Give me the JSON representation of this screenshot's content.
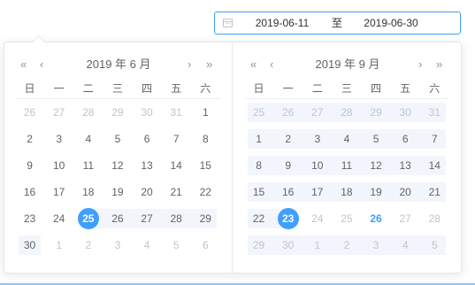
{
  "range_input": {
    "start": "2019-06-11",
    "separator": "至",
    "end": "2019-06-30"
  },
  "left": {
    "title": "2019 年 6 月",
    "weekdays": [
      "日",
      "一",
      "二",
      "三",
      "四",
      "五",
      "六"
    ],
    "rows": [
      [
        {
          "d": "26",
          "o": 1
        },
        {
          "d": "27",
          "o": 1
        },
        {
          "d": "28",
          "o": 1
        },
        {
          "d": "29",
          "o": 1
        },
        {
          "d": "30",
          "o": 1
        },
        {
          "d": "31",
          "o": 1
        },
        {
          "d": "1"
        }
      ],
      [
        {
          "d": "2"
        },
        {
          "d": "3"
        },
        {
          "d": "4"
        },
        {
          "d": "5"
        },
        {
          "d": "6"
        },
        {
          "d": "7"
        },
        {
          "d": "8"
        }
      ],
      [
        {
          "d": "9"
        },
        {
          "d": "10"
        },
        {
          "d": "11"
        },
        {
          "d": "12"
        },
        {
          "d": "13"
        },
        {
          "d": "14"
        },
        {
          "d": "15"
        }
      ],
      [
        {
          "d": "16"
        },
        {
          "d": "17"
        },
        {
          "d": "18"
        },
        {
          "d": "19"
        },
        {
          "d": "20"
        },
        {
          "d": "21"
        },
        {
          "d": "22"
        }
      ],
      [
        {
          "d": "23"
        },
        {
          "d": "24"
        },
        {
          "d": "25",
          "s": 1,
          "r": "start"
        },
        {
          "d": "26",
          "r": 1
        },
        {
          "d": "27",
          "r": 1
        },
        {
          "d": "28",
          "r": 1
        },
        {
          "d": "29",
          "r": 1
        }
      ],
      [
        {
          "d": "30",
          "r": 1
        },
        {
          "d": "1",
          "o": 1
        },
        {
          "d": "2",
          "o": 1
        },
        {
          "d": "3",
          "o": 1
        },
        {
          "d": "4",
          "o": 1
        },
        {
          "d": "5",
          "o": 1
        },
        {
          "d": "6",
          "o": 1
        }
      ]
    ]
  },
  "right": {
    "title": "2019 年 9 月",
    "weekdays": [
      "日",
      "一",
      "二",
      "三",
      "四",
      "五",
      "六"
    ],
    "rows": [
      [
        {
          "d": "25",
          "o": 1,
          "r": 1
        },
        {
          "d": "26",
          "o": 1,
          "r": 1
        },
        {
          "d": "27",
          "o": 1,
          "r": 1
        },
        {
          "d": "28",
          "o": 1,
          "r": 1
        },
        {
          "d": "29",
          "o": 1,
          "r": 1
        },
        {
          "d": "30",
          "o": 1,
          "r": 1
        },
        {
          "d": "31",
          "o": 1,
          "r": 1
        }
      ],
      [
        {
          "d": "1",
          "r": 1
        },
        {
          "d": "2",
          "r": 1
        },
        {
          "d": "3",
          "r": 1
        },
        {
          "d": "4",
          "r": 1
        },
        {
          "d": "5",
          "r": 1
        },
        {
          "d": "6",
          "r": 1
        },
        {
          "d": "7",
          "r": 1
        }
      ],
      [
        {
          "d": "8",
          "r": 1
        },
        {
          "d": "9",
          "r": 1
        },
        {
          "d": "10",
          "r": 1
        },
        {
          "d": "11",
          "r": 1
        },
        {
          "d": "12",
          "r": 1
        },
        {
          "d": "13",
          "r": 1
        },
        {
          "d": "14",
          "r": 1
        }
      ],
      [
        {
          "d": "15",
          "r": 1
        },
        {
          "d": "16",
          "r": 1
        },
        {
          "d": "17",
          "r": 1
        },
        {
          "d": "18",
          "r": 1
        },
        {
          "d": "19",
          "r": 1
        },
        {
          "d": "20",
          "r": 1
        },
        {
          "d": "21",
          "r": 1
        }
      ],
      [
        {
          "d": "22",
          "r": 1
        },
        {
          "d": "23",
          "s": 1,
          "r": "end"
        },
        {
          "d": "24",
          "o": 1
        },
        {
          "d": "25",
          "o": 1
        },
        {
          "d": "26",
          "t": 1
        },
        {
          "d": "27",
          "o": 1
        },
        {
          "d": "28",
          "o": 1
        }
      ],
      [
        {
          "d": "29",
          "o": 1,
          "r": 1
        },
        {
          "d": "30",
          "o": 1,
          "r": 1
        },
        {
          "d": "1",
          "o": 1,
          "r": 1
        },
        {
          "d": "2",
          "o": 1,
          "r": 1
        },
        {
          "d": "3",
          "o": 1,
          "r": 1
        },
        {
          "d": "4",
          "o": 1,
          "r": 1
        },
        {
          "d": "5",
          "o": 1,
          "r": 1
        }
      ]
    ]
  },
  "nav": {
    "prev_year": "«",
    "prev_month": "‹",
    "next_month": "›",
    "next_year": "»"
  },
  "colors": {
    "accent": "#409eff",
    "range_bg": "#f2f6fc",
    "muted": "#c0c4cc"
  }
}
